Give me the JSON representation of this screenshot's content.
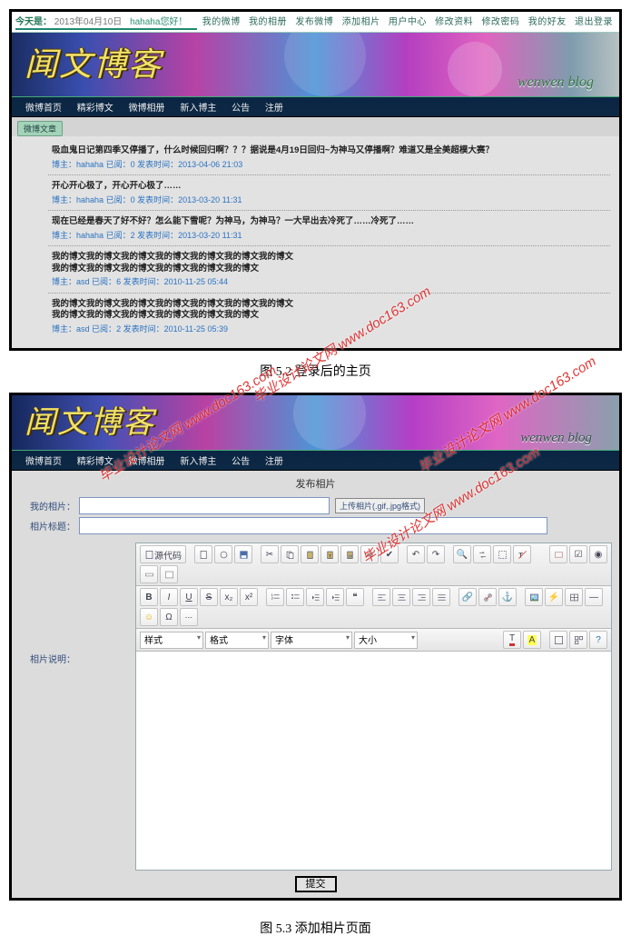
{
  "topbar": {
    "today_label": "今天是：",
    "date": "2013年04月10日",
    "greeting_user": "hahaha",
    "greeting_suffix": "您好！",
    "links": [
      "我的微博",
      "我的相册",
      "发布微博",
      "添加相片",
      "用户中心",
      "修改资料",
      "修改密码",
      "我的好友",
      "退出登录"
    ]
  },
  "banner": {
    "title": "闻文博客",
    "subtitle": "wenwen blog"
  },
  "nav": {
    "items": [
      "微博首页",
      "精彩博文",
      "微博相册",
      "新入博主",
      "公告",
      "注册"
    ]
  },
  "section_tag": "微博文章",
  "posts": [
    {
      "title": "吸血鬼日记第四季又停播了，什么时候回归啊？？？据说是4月19日回归~为神马又停播啊？难道又是全美超模大赛？",
      "author_label": "博主：",
      "author": "hahaha",
      "read_label": "已阅：",
      "read": "0",
      "time_label": "发表时间：",
      "time": "2013-04-06 21:03"
    },
    {
      "title": "开心开心极了，开心开心极了……",
      "author_label": "博主：",
      "author": "hahaha",
      "read_label": "已阅：",
      "read": "0",
      "time_label": "发表时间：",
      "time": "2013-03-20 11:31"
    },
    {
      "title": "现在已经是春天了好不好？怎么能下雪呢？为神马，为神马？一大早出去冷死了……冷死了……",
      "author_label": "博主：",
      "author": "hahaha",
      "read_label": "已阅：",
      "read": "2",
      "time_label": "发表时间：",
      "time": "2013-03-20 11:31"
    },
    {
      "title": "我的博文我的博文我的博文我的博文我的博文我的博文我的博文\n我的博文我的博文我的博文我的博文我的博文我的博文",
      "author_label": "博主：",
      "author": "asd",
      "read_label": "已阅：",
      "read": "6",
      "time_label": "发表时间：",
      "time": "2010-11-25 05:44"
    },
    {
      "title": "我的博文我的博文我的博文我的博文我的博文我的博文我的博文\n我的博文我的博文我的博文我的博文我的博文我的博文",
      "author_label": "博主：",
      "author": "asd",
      "read_label": "已阅：",
      "read": "2",
      "time_label": "发表时间：",
      "time": "2010-11-25 05:39"
    }
  ],
  "caption1": "图 5.2  登录后的主页",
  "watermarks": {
    "wm_text": "毕业设计论文网  www.doc163.com"
  },
  "shot2": {
    "form_title": "发布相片",
    "label_photo": "我的相片：",
    "upload_btn": "上传相片(.gif,.jpg格式)",
    "label_title": "相片标题：",
    "label_desc": "相片说明：",
    "toolbar": {
      "source_btn": "源代码",
      "style_sel": "样式",
      "format_sel": "格式",
      "font_sel": "字体",
      "size_sel": "大小"
    },
    "submit_btn": "提交"
  },
  "caption2": "图 5.3    添加相片页面"
}
